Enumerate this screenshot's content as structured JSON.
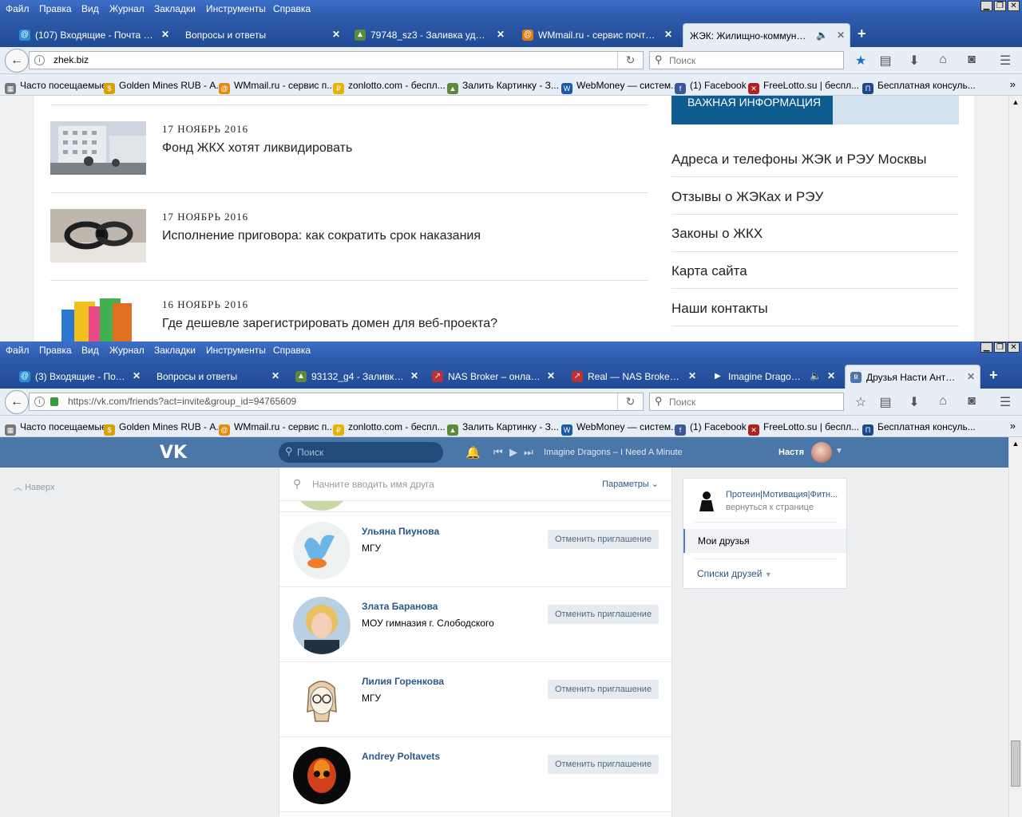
{
  "window_top": {
    "menu": [
      "Файл",
      "Правка",
      "Вид",
      "Журнал",
      "Закладки",
      "Инструменты",
      "Справка"
    ],
    "tabs": [
      {
        "title": "(107) Входящие - Почта Mail...",
        "icon": "mail-icon",
        "icon_color": "#2b8fd6"
      },
      {
        "title": "Вопросы и ответы",
        "icon": "",
        "icon_color": ""
      },
      {
        "title": "79748_sz3 - Заливка удалас...",
        "icon": "image-icon",
        "icon_color": "#5a8a3a"
      },
      {
        "title": "WMmail.ru - сервис почтовы...",
        "icon": "at-icon",
        "icon_color": "#e07a10"
      },
      {
        "title": "ЖЭК: Жилищно-коммунальн...",
        "icon": "",
        "icon_color": ""
      }
    ],
    "url": "zhek.biz",
    "search_placeholder": "Поиск",
    "bookmarks": [
      "Часто посещаемые",
      "Golden Mines RUB - А...",
      "WMmail.ru - сервис п...",
      "zonlotto.com - беспл...",
      "Залить Картинку - З...",
      "WebMoney — систем...",
      "(1) Facebook",
      "FreeLotto.su | беспл...",
      "Бесплатная консуль..."
    ],
    "news": [
      {
        "date": "17 НОЯБРЬ 2016",
        "title": "Фонд ЖКХ хотят ликвидировать"
      },
      {
        "date": "17 НОЯБРЬ 2016",
        "title": "Исполнение приговора: как сократить срок наказания"
      },
      {
        "date": "16 НОЯБРЬ 2016",
        "title": "Где дешевле зарегистрировать домен для веб-проекта?"
      }
    ],
    "info_header": "ВАЖНАЯ ИНФОРМАЦИЯ",
    "side_links": [
      "Адреса и телефоны ЖЭК и РЭУ Москвы",
      "Отзывы о ЖЭКах и РЭУ",
      "Законы о ЖКХ",
      "Карта сайта",
      "Наши контакты"
    ]
  },
  "window_bottom": {
    "menu": [
      "Файл",
      "Правка",
      "Вид",
      "Журнал",
      "Закладки",
      "Инструменты",
      "Справка"
    ],
    "tabs": [
      {
        "title": "(3) Входящие - Почт...",
        "icon": "mail-icon",
        "icon_color": "#2b8fd6"
      },
      {
        "title": "Вопросы и ответы",
        "icon": "",
        "icon_color": ""
      },
      {
        "title": "93132_g4 - Заливка ...",
        "icon": "image-icon",
        "icon_color": "#5a8a3a"
      },
      {
        "title": "NAS Broker – онлайн ...",
        "icon": "chart-icon",
        "icon_color": "#c03030"
      },
      {
        "title": "Real — NAS Broker W...",
        "icon": "chart-icon",
        "icon_color": "#c03030"
      },
      {
        "title": "Imagine Dragons ...",
        "icon": "play-icon",
        "icon_color": "#4a76a8"
      },
      {
        "title": "Друзья Насти Антип...",
        "icon": "vk-icon",
        "icon_color": "#4a76a8"
      }
    ],
    "url": "https://vk.com/friends?act=invite&group_id=94765609",
    "search_placeholder": "Поиск",
    "bookmarks": [
      "Часто посещаемые",
      "Golden Mines RUB - А...",
      "WMmail.ru - сервис п...",
      "zonlotto.com - беспл...",
      "Залить Картинку - З...",
      "WebMoney — систем...",
      "(1) Facebook",
      "FreeLotto.su | беспл...",
      "Бесплатная консуль..."
    ],
    "vk": {
      "search_placeholder": "Поиск",
      "track": "Imagine Dragons – I Need A Minute",
      "user": "Настя",
      "up_label": "Наверх",
      "friend_search_placeholder": "Начните вводить имя друга",
      "params_label": "Параметры",
      "cancel_label": "Отменить приглашение",
      "friends": [
        {
          "name": "Ульяна Пиунова",
          "sub": "МГУ"
        },
        {
          "name": "Злата Баранова",
          "sub": "МОУ гимназия г. Слободского"
        },
        {
          "name": "Лилия Горенкова",
          "sub": "МГУ"
        },
        {
          "name": "Andrey Poltavets",
          "sub": ""
        }
      ],
      "group_name": "Протеин|Мотивация|Фитн...",
      "group_back": "вернуться к странице",
      "my_friends": "Мои друзья",
      "friend_lists": "Списки друзей"
    }
  }
}
